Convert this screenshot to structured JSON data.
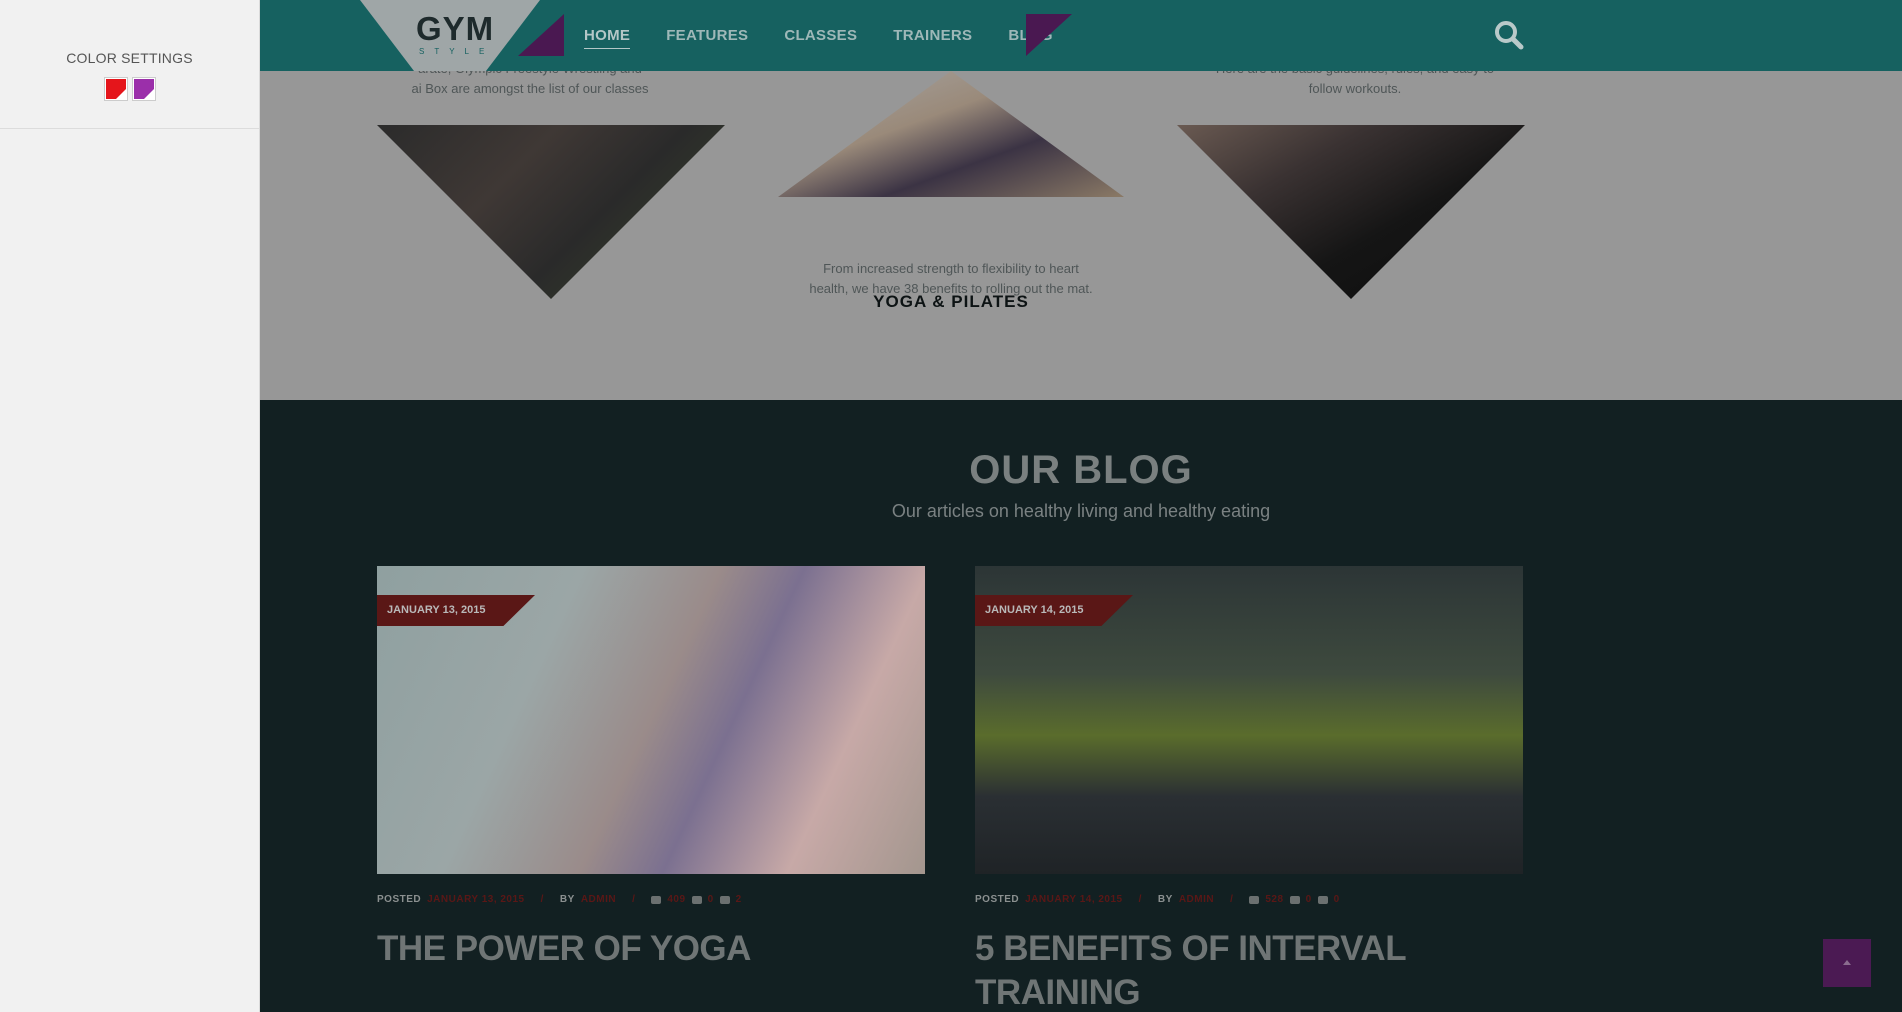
{
  "settings": {
    "title": "COLOR SETTINGS",
    "swatches": [
      {
        "name": "red",
        "color": "#e5151b"
      },
      {
        "name": "purple",
        "color": "#9b2faa"
      }
    ]
  },
  "header": {
    "logo": "GYM",
    "logo_sub": "STYLE",
    "nav": [
      {
        "label": "HOME",
        "active": true
      },
      {
        "label": "FEATURES",
        "active": false
      },
      {
        "label": "CLASSES",
        "active": false
      },
      {
        "label": "TRAINERS",
        "active": false
      },
      {
        "label": "BLOG",
        "active": false
      }
    ],
    "search_icon": "search-icon"
  },
  "classes": {
    "left_text_1": "arate, Olympic Freestyle Wrestling and",
    "left_text_2": "ai Box are amongst the list of our classes",
    "right_text_1": "Here are the basic guidelines, rules, and easy to",
    "right_text_2": "follow workouts.",
    "center_title": "YOGA & PILATES",
    "center_text_1": "From increased strength to flexibility to heart",
    "center_text_2": "health, we have 38 benefits to rolling out the mat."
  },
  "blog": {
    "title": "OUR BLOG",
    "subtitle": "Our articles on healthy living and healthy eating",
    "posts": [
      {
        "date": "JANUARY 13, 2015",
        "posted_label": "POSTED",
        "posted_date": "JANUARY 13, 2015",
        "by_label": "BY",
        "author": "ADMIN",
        "views": "409",
        "comments": "0",
        "likes": "2",
        "title": "THE POWER OF YOGA"
      },
      {
        "date": "JANUARY 14, 2015",
        "posted_label": "POSTED",
        "posted_date": "JANUARY 14, 2015",
        "by_label": "BY",
        "author": "ADMIN",
        "views": "528",
        "comments": "0",
        "likes": "0",
        "title": "5 BENEFITS OF INTERVAL TRAINING"
      }
    ]
  },
  "colors": {
    "header_bg": "#166160",
    "accent_purple": "#4a1851",
    "accent_red": "#5a1716",
    "dark_bg": "#122022"
  }
}
